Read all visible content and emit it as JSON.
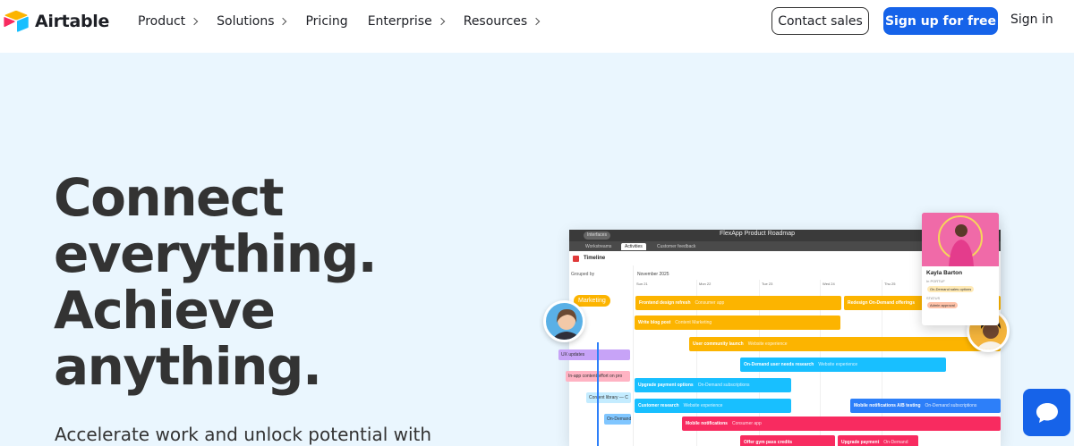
{
  "brand": {
    "name": "Airtable"
  },
  "nav": {
    "items": [
      {
        "label": "Product",
        "has_chevron": true
      },
      {
        "label": "Solutions",
        "has_chevron": true
      },
      {
        "label": "Pricing",
        "has_chevron": false
      },
      {
        "label": "Enterprise",
        "has_chevron": true
      },
      {
        "label": "Resources",
        "has_chevron": true
      }
    ],
    "contact_sales": "Contact sales",
    "sign_up": "Sign up for free",
    "sign_in": "Sign in"
  },
  "hero": {
    "title_lines": [
      "Connect",
      "everything.",
      "Achieve",
      "anything."
    ],
    "subtitle": "Accelerate work and unlock potential with"
  },
  "mockup": {
    "window_title": "FlexApp Product Roadmap",
    "interfaces_pill": "Interfaces",
    "tabs": [
      "Workstreams",
      "Activities",
      "Customer feedback"
    ],
    "active_tab": 1,
    "view_name": "Timeline",
    "group_label": "Grouped by",
    "month": "November 2025",
    "days": [
      "Sun 21",
      "Mon 22",
      "Tue 23",
      "Wed 24",
      "Thu 25"
    ],
    "marketing_tag": "Marketing",
    "bars": [
      {
        "title": "Frontend design refresh",
        "sub": "Consumer app",
        "color": "y"
      },
      {
        "title": "Redesign On-Demand offerings",
        "sub": "",
        "color": "y"
      },
      {
        "title": "Write blog post",
        "sub": "Content Marketing",
        "color": "y"
      },
      {
        "title": "User community launch",
        "sub": "Website experience",
        "color": "y"
      },
      {
        "title": "On-Demand user needs research",
        "sub": "Website experience",
        "color": "b"
      },
      {
        "title": "Upgrade payment options",
        "sub": "On-Demand subscriptions",
        "color": "b"
      },
      {
        "title": "Customer research",
        "sub": "Website experience",
        "color": "b"
      },
      {
        "title": "Mobile notifications A/B testing",
        "sub": "On-Demand subscriptions",
        "color": "bd"
      },
      {
        "title": "Mobile notifications",
        "sub": "Consumer app",
        "color": "p"
      },
      {
        "title": "Offer gym pass credits",
        "sub": "",
        "color": "p"
      },
      {
        "title": "Upgrade payment",
        "sub": "On-Demand",
        "color": "p"
      }
    ],
    "left_bars": [
      "UX updates",
      "In-app content effort on pro",
      "Content library — C",
      "On-Demand"
    ],
    "profile": {
      "name": "Kayla Barton",
      "field1_label": "In PORTUF",
      "chip1": "On-Demand sales options",
      "field2_label": "STATUS",
      "chip2": "Admin approval"
    }
  },
  "colors": {
    "accent": "#1663e9",
    "hero_bg": "#eaf6fe",
    "yellow": "#fcb400",
    "cyan": "#18bfff",
    "pink": "#f82b60"
  },
  "icons": {
    "chat": "chat-bubble-icon",
    "logo": "airtable-logo-icon"
  }
}
